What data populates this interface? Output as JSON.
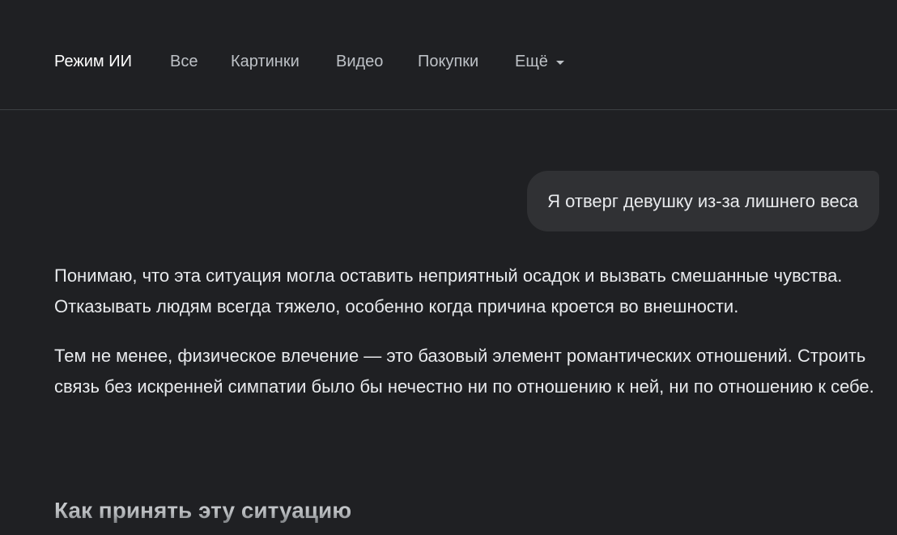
{
  "nav": {
    "tabs": [
      {
        "label": "Режим ИИ",
        "active": true
      },
      {
        "label": "Все",
        "active": false
      },
      {
        "label": "Картинки",
        "active": false
      },
      {
        "label": "Видео",
        "active": false
      },
      {
        "label": "Покупки",
        "active": false
      }
    ],
    "more_label": "Ещё",
    "more_icon": "caret-down-icon"
  },
  "conversation": {
    "user_message": "Я отверг девушку из-за лишнего веса",
    "response": {
      "paragraphs": [
        "Понимаю, что эта ситуация могла оставить неприятный осадок и вызвать смешанные чувства. Отказывать людям всегда тяжело, особенно когда причина кроется во внешности.",
        "Тем не менее, физическое влечение — это базовый элемент романтических отношений. Строить связь без искренней симпатии было бы нечестно ни по отношению к ней, ни по отношению к себе."
      ],
      "heading": "Как принять эту ситуацию"
    }
  },
  "colors": {
    "background": "#1f2023",
    "bubble": "#303134",
    "text": "#e8eaed",
    "tab_inactive": "#bdc1c6",
    "divider": "#3c4043"
  }
}
